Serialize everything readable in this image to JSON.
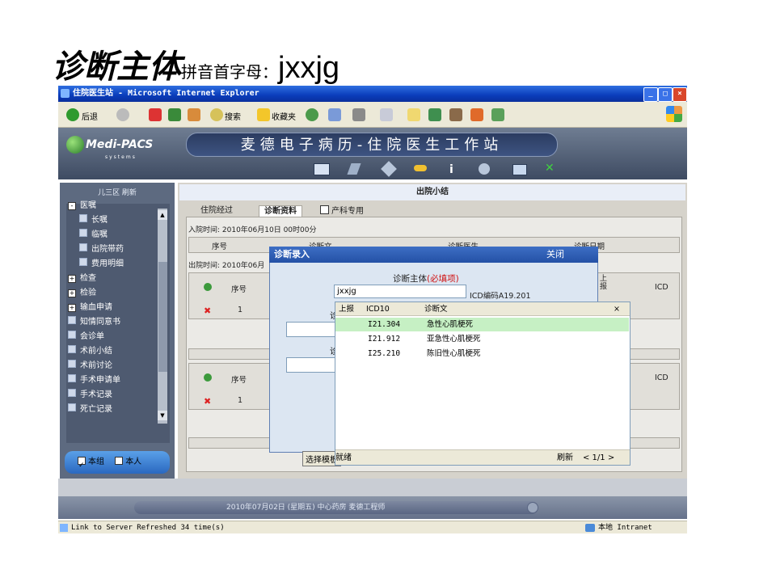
{
  "slide": {
    "title_main": "诊断主体",
    "title_sub": "拼音首字母：",
    "title_code": "jxxjg"
  },
  "browser": {
    "title": "住院医生站 - Microsoft Internet Explorer",
    "back_label": "后退",
    "search_label": "搜索",
    "favorites_label": "收藏夹",
    "status_text": "Link to Server Refreshed 34 time(s)",
    "zone_label": "本地 Intranet"
  },
  "app": {
    "logo_text": "Medi-PACS",
    "logo_sub": "systems",
    "banner": "麦德电子病历-住院医生工作站"
  },
  "sidebar": {
    "header": "儿三区  刷新",
    "items": [
      {
        "label": "医嘱",
        "icon": "minus-box-icon"
      },
      {
        "label": "长嘱",
        "icon": "doc-icon"
      },
      {
        "label": "临嘱",
        "icon": "doc-icon"
      },
      {
        "label": "出院带药",
        "icon": "doc-icon"
      },
      {
        "label": "费用明细",
        "icon": "doc-icon"
      },
      {
        "label": "检查",
        "icon": "plus-box-icon"
      },
      {
        "label": "检验",
        "icon": "plus-box-icon"
      },
      {
        "label": "输血申请",
        "icon": "plus-box-icon"
      },
      {
        "label": "知情同意书",
        "icon": "doc-icon"
      },
      {
        "label": "会诊单",
        "icon": "doc-icon"
      },
      {
        "label": "术前小结",
        "icon": "doc-icon"
      },
      {
        "label": "术前讨论",
        "icon": "doc-icon"
      },
      {
        "label": "手术申请单",
        "icon": "doc-icon"
      },
      {
        "label": "手术记录",
        "icon": "doc-icon"
      },
      {
        "label": "死亡记录",
        "icon": "doc-icon"
      }
    ],
    "footer_group": "本组",
    "footer_self": "本人"
  },
  "main": {
    "title": "出院小结",
    "tabs": [
      "住院经过",
      "诊断资料",
      "产科专用"
    ],
    "admit_line": "入院时间: 2010年06月10日  00时00分",
    "discharge_line": "出院时间: 2010年06月",
    "table1_headers": [
      "序号",
      "诊断文",
      "诊断医生",
      "诊断日期"
    ],
    "grid_seq": "序号",
    "grid_row1": "1",
    "grid_icd": "ICD",
    "grid_report": "上报",
    "bottom_button": "选择模板"
  },
  "dialog": {
    "title": "诊断录入",
    "close_label": "关闭",
    "field_label": "诊断主体",
    "required_text": "(必填项)",
    "input_value": "jxxjg",
    "icd_hint": "ICD编码A19.201"
  },
  "popup": {
    "headers": [
      "上报",
      "ICD10",
      "诊断文"
    ],
    "rows": [
      {
        "icd": "I21.304",
        "name": "急性心肌梗死",
        "selected": true
      },
      {
        "icd": "I21.912",
        "name": "亚急性心肌梗死",
        "selected": false
      },
      {
        "icd": "I25.210",
        "name": "陈旧性心肌梗死",
        "selected": false
      }
    ],
    "close_label": "×",
    "footer_left": "就绪",
    "footer_refresh": "刷新",
    "footer_pager": "< 1/1 >"
  },
  "footer": {
    "status": "2010年07月02日 (星期五)    中心药房  麦德工程师"
  },
  "colors": {
    "xp_blue": "#0a3dbb",
    "selected_row": "#c6f0c4",
    "required": "#d01010"
  }
}
